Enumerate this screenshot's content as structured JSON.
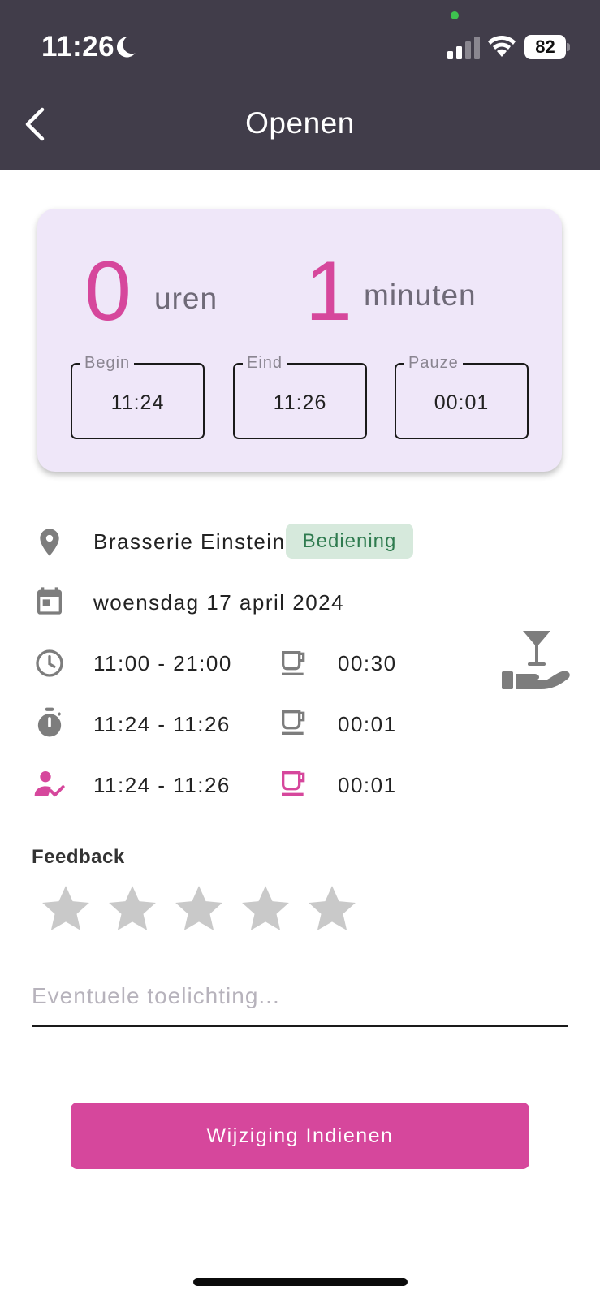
{
  "status_bar": {
    "time": "11:26",
    "battery": "82"
  },
  "header": {
    "title": "Openen"
  },
  "summary": {
    "hours": "0",
    "hours_unit": "uren",
    "minutes": "1",
    "minutes_unit": "minuten",
    "fields": [
      {
        "label": "Begin",
        "value": "11:24"
      },
      {
        "label": "Eind",
        "value": "11:26"
      },
      {
        "label": "Pauze",
        "value": "00:01"
      }
    ]
  },
  "details": {
    "location": "Brasserie Einstein",
    "role_badge": "Bediening",
    "date": "woensdag 17 april 2024",
    "rows": [
      {
        "icon": "clock-icon",
        "time_range": "11:00 - 21:00",
        "break_icon": "coffee-cup-icon",
        "break": "00:30"
      },
      {
        "icon": "stopwatch-icon",
        "time_range": "11:24 - 11:26",
        "break_icon": "coffee-cup-icon",
        "break": "00:01"
      },
      {
        "icon": "person-check-icon",
        "time_range": "11:24 - 11:26",
        "break_icon": "coffee-cup-icon",
        "break": "00:01"
      }
    ]
  },
  "feedback": {
    "title": "Feedback",
    "rating": 0,
    "max_rating": 5,
    "comment_placeholder": "Eventuele toelichting...",
    "comment_value": ""
  },
  "actions": {
    "submit_label": "Wijziging Indienen"
  },
  "colors": {
    "accent": "#d6479c",
    "header_bg": "#413d4a",
    "card_bg": "#efe7f9",
    "badge_bg": "#d6e9dc",
    "badge_text": "#2f7b4f",
    "star_empty": "#c9c9c9",
    "icon_gray": "#7d7d7d"
  }
}
